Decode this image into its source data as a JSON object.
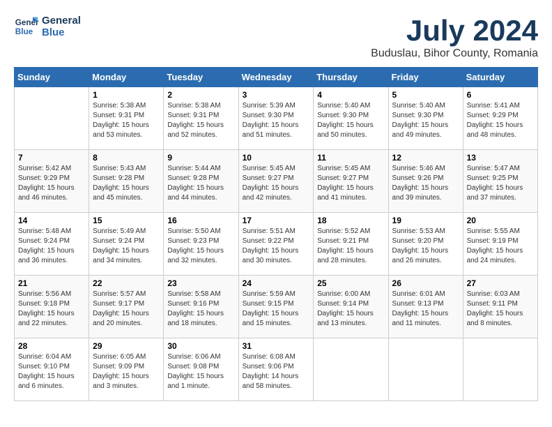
{
  "logo": {
    "line1": "General",
    "line2": "Blue"
  },
  "title": "July 2024",
  "location": "Buduslau, Bihor County, Romania",
  "weekdays": [
    "Sunday",
    "Monday",
    "Tuesday",
    "Wednesday",
    "Thursday",
    "Friday",
    "Saturday"
  ],
  "weeks": [
    [
      {
        "day": "",
        "info": ""
      },
      {
        "day": "1",
        "info": "Sunrise: 5:38 AM\nSunset: 9:31 PM\nDaylight: 15 hours\nand 53 minutes."
      },
      {
        "day": "2",
        "info": "Sunrise: 5:38 AM\nSunset: 9:31 PM\nDaylight: 15 hours\nand 52 minutes."
      },
      {
        "day": "3",
        "info": "Sunrise: 5:39 AM\nSunset: 9:30 PM\nDaylight: 15 hours\nand 51 minutes."
      },
      {
        "day": "4",
        "info": "Sunrise: 5:40 AM\nSunset: 9:30 PM\nDaylight: 15 hours\nand 50 minutes."
      },
      {
        "day": "5",
        "info": "Sunrise: 5:40 AM\nSunset: 9:30 PM\nDaylight: 15 hours\nand 49 minutes."
      },
      {
        "day": "6",
        "info": "Sunrise: 5:41 AM\nSunset: 9:29 PM\nDaylight: 15 hours\nand 48 minutes."
      }
    ],
    [
      {
        "day": "7",
        "info": "Sunrise: 5:42 AM\nSunset: 9:29 PM\nDaylight: 15 hours\nand 46 minutes."
      },
      {
        "day": "8",
        "info": "Sunrise: 5:43 AM\nSunset: 9:28 PM\nDaylight: 15 hours\nand 45 minutes."
      },
      {
        "day": "9",
        "info": "Sunrise: 5:44 AM\nSunset: 9:28 PM\nDaylight: 15 hours\nand 44 minutes."
      },
      {
        "day": "10",
        "info": "Sunrise: 5:45 AM\nSunset: 9:27 PM\nDaylight: 15 hours\nand 42 minutes."
      },
      {
        "day": "11",
        "info": "Sunrise: 5:45 AM\nSunset: 9:27 PM\nDaylight: 15 hours\nand 41 minutes."
      },
      {
        "day": "12",
        "info": "Sunrise: 5:46 AM\nSunset: 9:26 PM\nDaylight: 15 hours\nand 39 minutes."
      },
      {
        "day": "13",
        "info": "Sunrise: 5:47 AM\nSunset: 9:25 PM\nDaylight: 15 hours\nand 37 minutes."
      }
    ],
    [
      {
        "day": "14",
        "info": "Sunrise: 5:48 AM\nSunset: 9:24 PM\nDaylight: 15 hours\nand 36 minutes."
      },
      {
        "day": "15",
        "info": "Sunrise: 5:49 AM\nSunset: 9:24 PM\nDaylight: 15 hours\nand 34 minutes."
      },
      {
        "day": "16",
        "info": "Sunrise: 5:50 AM\nSunset: 9:23 PM\nDaylight: 15 hours\nand 32 minutes."
      },
      {
        "day": "17",
        "info": "Sunrise: 5:51 AM\nSunset: 9:22 PM\nDaylight: 15 hours\nand 30 minutes."
      },
      {
        "day": "18",
        "info": "Sunrise: 5:52 AM\nSunset: 9:21 PM\nDaylight: 15 hours\nand 28 minutes."
      },
      {
        "day": "19",
        "info": "Sunrise: 5:53 AM\nSunset: 9:20 PM\nDaylight: 15 hours\nand 26 minutes."
      },
      {
        "day": "20",
        "info": "Sunrise: 5:55 AM\nSunset: 9:19 PM\nDaylight: 15 hours\nand 24 minutes."
      }
    ],
    [
      {
        "day": "21",
        "info": "Sunrise: 5:56 AM\nSunset: 9:18 PM\nDaylight: 15 hours\nand 22 minutes."
      },
      {
        "day": "22",
        "info": "Sunrise: 5:57 AM\nSunset: 9:17 PM\nDaylight: 15 hours\nand 20 minutes."
      },
      {
        "day": "23",
        "info": "Sunrise: 5:58 AM\nSunset: 9:16 PM\nDaylight: 15 hours\nand 18 minutes."
      },
      {
        "day": "24",
        "info": "Sunrise: 5:59 AM\nSunset: 9:15 PM\nDaylight: 15 hours\nand 15 minutes."
      },
      {
        "day": "25",
        "info": "Sunrise: 6:00 AM\nSunset: 9:14 PM\nDaylight: 15 hours\nand 13 minutes."
      },
      {
        "day": "26",
        "info": "Sunrise: 6:01 AM\nSunset: 9:13 PM\nDaylight: 15 hours\nand 11 minutes."
      },
      {
        "day": "27",
        "info": "Sunrise: 6:03 AM\nSunset: 9:11 PM\nDaylight: 15 hours\nand 8 minutes."
      }
    ],
    [
      {
        "day": "28",
        "info": "Sunrise: 6:04 AM\nSunset: 9:10 PM\nDaylight: 15 hours\nand 6 minutes."
      },
      {
        "day": "29",
        "info": "Sunrise: 6:05 AM\nSunset: 9:09 PM\nDaylight: 15 hours\nand 3 minutes."
      },
      {
        "day": "30",
        "info": "Sunrise: 6:06 AM\nSunset: 9:08 PM\nDaylight: 15 hours\nand 1 minute."
      },
      {
        "day": "31",
        "info": "Sunrise: 6:08 AM\nSunset: 9:06 PM\nDaylight: 14 hours\nand 58 minutes."
      },
      {
        "day": "",
        "info": ""
      },
      {
        "day": "",
        "info": ""
      },
      {
        "day": "",
        "info": ""
      }
    ]
  ]
}
